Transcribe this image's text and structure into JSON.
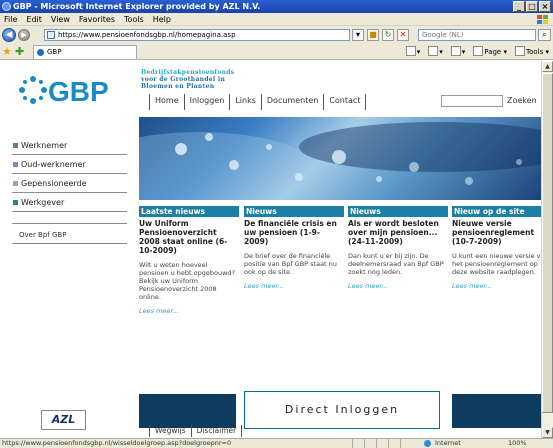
{
  "window": {
    "title": "GBP - Microsoft Internet Explorer provided by AZL N.V.",
    "buttons": [
      "_",
      "□",
      "×"
    ]
  },
  "menu": [
    "File",
    "Edit",
    "View",
    "Favorites",
    "Tools",
    "Help"
  ],
  "address": {
    "url": "https://www.pensioenfondsgbp.nl/homepagina.asp",
    "search_placeholder": "Google (NL)"
  },
  "tab": {
    "label": "GBP"
  },
  "commandbar": {
    "page": "Page",
    "tools": "Tools"
  },
  "site": {
    "logo_text": "GBP",
    "tagline": [
      "Bedrijfstakpensioenfonds",
      "voor de Groothandel in",
      "Bloemen en Planten"
    ],
    "topnav": [
      "Home",
      "Inloggen",
      "Links",
      "Documenten",
      "Contact"
    ],
    "search_label": "Zoeken",
    "sidenav": [
      {
        "label": "Werknemer",
        "color": "#5b7fa8"
      },
      {
        "label": "Oud-werknemer",
        "color": "#7b8cc0"
      },
      {
        "label": "Gepensioneerde",
        "color": "#9aa0bc"
      },
      {
        "label": "Werkgever",
        "color": "#1c8a8c"
      }
    ],
    "about": "Over Bpf GBP",
    "columns": [
      {
        "head": "Laatste nieuws",
        "title": "Uw Uniform Pensioenoverzicht 2008 staat online (6-10-2009)",
        "body": "Wilt u weten hoeveel pensioen u hebt opgebouwd? Bekijk uw Uniform Pensioenoverzicht 2008 online.",
        "more": "Lees meer..."
      },
      {
        "head": "Nieuws",
        "title": "De financiële crisis en uw pensioen (1-9-2009)",
        "body": "De brief over de financiële positie van Bpf GBP staat nu ook op de site.",
        "more": "Lees meer..."
      },
      {
        "head": "Nieuws",
        "title": "Als er wordt besloten over mijn pensioen... (24-11-2009)",
        "body": "Dan kunt u er bij zijn. De deelnemersraad van Bpf GBP zoekt nog leden.",
        "more": "Lees meer..."
      },
      {
        "head": "Nieuw op de site",
        "title": "Nieuwe versie pensioenreglement (10-7-2009)",
        "body": "U kunt een nieuwe versie van het pensioenreglement op deze website raadplegen.",
        "more": "Lees meer..."
      }
    ],
    "bottom_logo": "AZL",
    "direct_login": "Direct Inloggen",
    "footlinks": [
      "Wegwijs",
      "Disclaimer"
    ]
  },
  "status": {
    "url": "https://www.pensioenfondsgbp.nl/wisseldoelgroep.asp?doelgroepnr=0",
    "zone": "Internet",
    "zoom": "100%"
  },
  "icons": [
    "back-icon",
    "forward-icon",
    "ie-page-icon",
    "favorites-star-icon",
    "add-favorites-icon",
    "home-icon",
    "feeds-icon",
    "print-icon",
    "search-go-icon",
    "refresh-icon",
    "stop-icon",
    "globe-icon"
  ]
}
